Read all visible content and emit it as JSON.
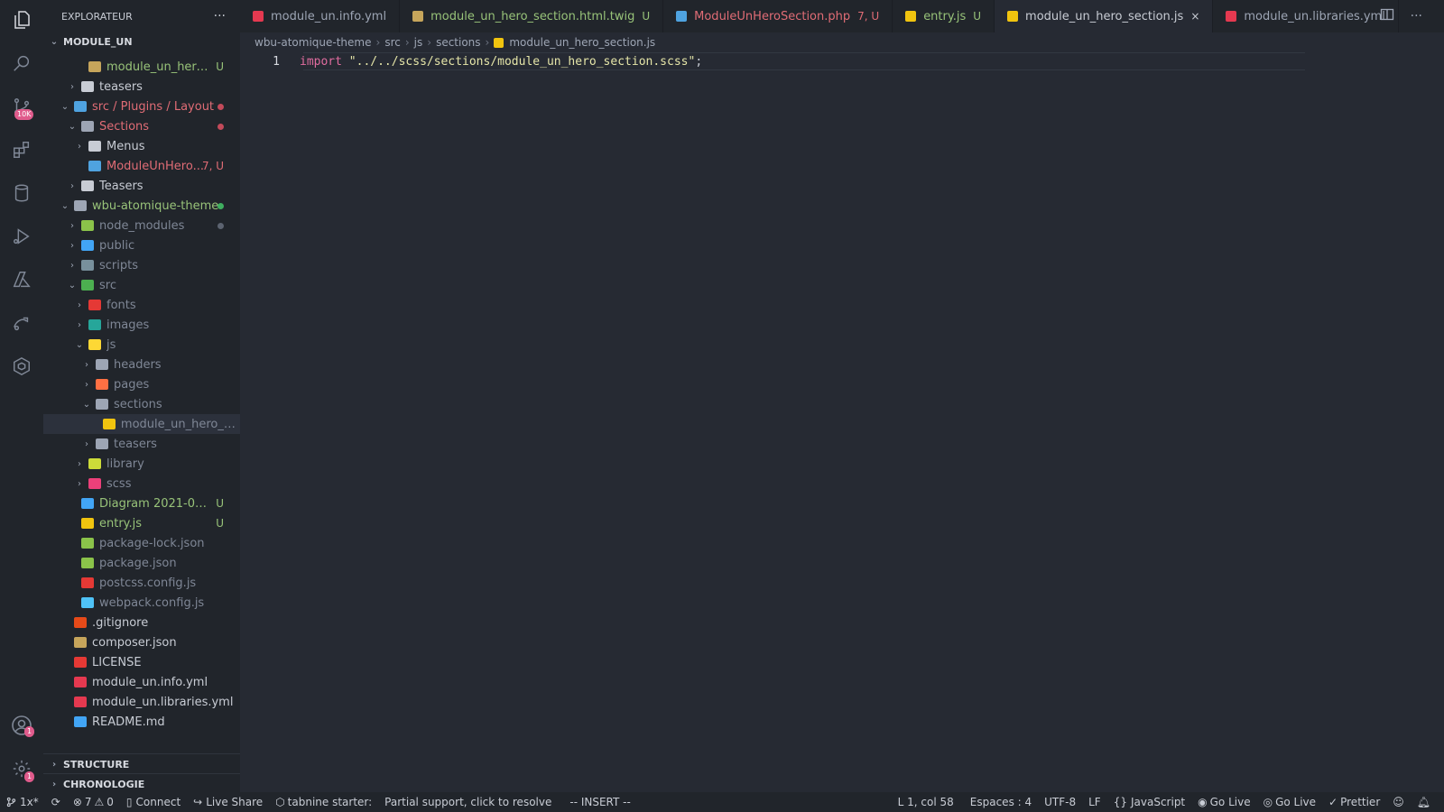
{
  "sidebar": {
    "title": "EXPLORATEUR",
    "more": "···",
    "workspace": "MODULE_UN",
    "tree": [
      {
        "name": "module_un_hero...",
        "color": "#98c379",
        "icon": "#c6a55b",
        "depth": 3,
        "chev": "",
        "deco": "U",
        "decoColor": "#98c379"
      },
      {
        "name": "teasers",
        "color": "#c8ccd4",
        "icon": "#c8ccd4",
        "depth": 2,
        "chev": "›"
      },
      {
        "name": "src / Plugins / Layout",
        "color": "#e06c75",
        "icon": "#4fa3e0",
        "depth": 1,
        "chev": "⌄",
        "dot": "#c24a5a"
      },
      {
        "name": "Sections",
        "color": "#e06c75",
        "icon": "#9da5b4",
        "depth": 2,
        "chev": "⌄",
        "dot": "#c24a5a"
      },
      {
        "name": "Menus",
        "color": "#c8ccd4",
        "icon": "#c8ccd4",
        "depth": 3,
        "chev": "›"
      },
      {
        "name": "ModuleUnHero...",
        "color": "#e06c75",
        "icon": "#4fa3e0",
        "depth": 3,
        "chev": "",
        "deco": "7, U",
        "decoColor": "#e06c75"
      },
      {
        "name": "Teasers",
        "color": "#c8ccd4",
        "icon": "#c8ccd4",
        "depth": 2,
        "chev": "›"
      },
      {
        "name": "wbu-atomique-theme",
        "color": "#98c379",
        "icon": "#9da5b4",
        "depth": 1,
        "chev": "⌄",
        "dot": "#3fae5f"
      },
      {
        "name": "node_modules",
        "color": "#7f8796",
        "icon": "#8bc34a",
        "depth": 2,
        "chev": "›",
        "dot": "#5c6370"
      },
      {
        "name": "public",
        "color": "#7f8796",
        "icon": "#42a5f5",
        "depth": 2,
        "chev": "›"
      },
      {
        "name": "scripts",
        "color": "#7f8796",
        "icon": "#78909c",
        "depth": 2,
        "chev": "›"
      },
      {
        "name": "src",
        "color": "#7f8796",
        "icon": "#4caf50",
        "depth": 2,
        "chev": "⌄"
      },
      {
        "name": "fonts",
        "color": "#7f8796",
        "icon": "#e53935",
        "depth": 3,
        "chev": "›"
      },
      {
        "name": "images",
        "color": "#7f8796",
        "icon": "#26a69a",
        "depth": 3,
        "chev": "›"
      },
      {
        "name": "js",
        "color": "#7f8796",
        "icon": "#fdd835",
        "depth": 3,
        "chev": "⌄"
      },
      {
        "name": "headers",
        "color": "#7f8796",
        "icon": "#9da5b4",
        "depth": 4,
        "chev": "›"
      },
      {
        "name": "pages",
        "color": "#7f8796",
        "icon": "#ff7043",
        "depth": 4,
        "chev": "›"
      },
      {
        "name": "sections",
        "color": "#7f8796",
        "icon": "#9da5b4",
        "depth": 4,
        "chev": "⌄"
      },
      {
        "name": "module_un_hero_s...",
        "color": "#7f8796",
        "icon": "#f1c40f",
        "depth": 5,
        "chev": "",
        "selected": true
      },
      {
        "name": "teasers",
        "color": "#7f8796",
        "icon": "#9da5b4",
        "depth": 4,
        "chev": "›"
      },
      {
        "name": "library",
        "color": "#7f8796",
        "icon": "#cddc39",
        "depth": 3,
        "chev": "›"
      },
      {
        "name": "scss",
        "color": "#7f8796",
        "icon": "#ec407a",
        "depth": 3,
        "chev": "›"
      },
      {
        "name": "Diagram 2021-04-...",
        "color": "#98c379",
        "icon": "#42a5f5",
        "depth": 2,
        "chev": "",
        "deco": "U",
        "decoColor": "#98c379"
      },
      {
        "name": "entry.js",
        "color": "#98c379",
        "icon": "#f1c40f",
        "depth": 2,
        "chev": "",
        "deco": "U",
        "decoColor": "#98c379"
      },
      {
        "name": "package-lock.json",
        "color": "#7f8796",
        "icon": "#8bc34a",
        "depth": 2,
        "chev": ""
      },
      {
        "name": "package.json",
        "color": "#7f8796",
        "icon": "#8bc34a",
        "depth": 2,
        "chev": ""
      },
      {
        "name": "postcss.config.js",
        "color": "#7f8796",
        "icon": "#e53935",
        "depth": 2,
        "chev": ""
      },
      {
        "name": "webpack.config.js",
        "color": "#7f8796",
        "icon": "#4fc3f7",
        "depth": 2,
        "chev": ""
      },
      {
        "name": ".gitignore",
        "color": "#c8ccd4",
        "icon": "#e64a19",
        "depth": 1,
        "chev": ""
      },
      {
        "name": "composer.json",
        "color": "#c8ccd4",
        "icon": "#c6a55b",
        "depth": 1,
        "chev": ""
      },
      {
        "name": "LICENSE",
        "color": "#c8ccd4",
        "icon": "#e53935",
        "depth": 1,
        "chev": ""
      },
      {
        "name": "module_un.info.yml",
        "color": "#c8ccd4",
        "icon": "#e53950",
        "depth": 1,
        "chev": ""
      },
      {
        "name": "module_un.libraries.yml",
        "color": "#c8ccd4",
        "icon": "#e53950",
        "depth": 1,
        "chev": ""
      },
      {
        "name": "README.md",
        "color": "#c8ccd4",
        "icon": "#42a5f5",
        "depth": 1,
        "chev": ""
      }
    ],
    "structure": "STRUCTURE",
    "chronologie": "CHRONOLOGIE"
  },
  "tabs": [
    {
      "label": "module_un.info.yml",
      "color": "#9da5b4",
      "icon": "#e53950",
      "deco": "",
      "active": false
    },
    {
      "label": "module_un_hero_section.html.twig",
      "color": "#98c379",
      "icon": "#c6a55b",
      "deco": "U",
      "decoColor": "#98c379",
      "active": false
    },
    {
      "label": "ModuleUnHeroSection.php",
      "color": "#e06c75",
      "icon": "#4fa3e0",
      "deco": "7, U",
      "decoColor": "#e06c75",
      "active": false
    },
    {
      "label": "entry.js",
      "color": "#98c379",
      "icon": "#f1c40f",
      "deco": "U",
      "decoColor": "#98c379",
      "active": false
    },
    {
      "label": "module_un_hero_section.js",
      "color": "#c8ccd4",
      "icon": "#f1c40f",
      "deco": "×",
      "decoColor": "#c8ccd4",
      "active": true
    },
    {
      "label": "module_un.libraries.yml",
      "color": "#9da5b4",
      "icon": "#e53950",
      "deco": "",
      "active": false
    }
  ],
  "breadcrumb": [
    "wbu-atomique-theme",
    "src",
    "js",
    "sections",
    "module_un_hero_section.js"
  ],
  "editor": {
    "line_number": "1",
    "keyword": "import",
    "string": "\"../../scss/sections/module_un_hero_section.scss\"",
    "semicolon": ";"
  },
  "activity": {
    "scm_badge": "10K",
    "accounts_badge": "1",
    "settings_badge": "1"
  },
  "status": {
    "branch": "1x*",
    "errors": "7",
    "warnings": "0",
    "connect": "Connect",
    "liveshare": "Live Share",
    "tabnine": "tabnine starter:",
    "partial": "Partial support, click to resolve",
    "mode": "-- INSERT --",
    "position": "L 1, col 58",
    "spaces": "Espaces : 4",
    "encoding": "UTF-8",
    "eol": "LF",
    "language": "JavaScript",
    "golive1": "Go Live",
    "golive2": "Go Live",
    "prettier": "Prettier"
  }
}
